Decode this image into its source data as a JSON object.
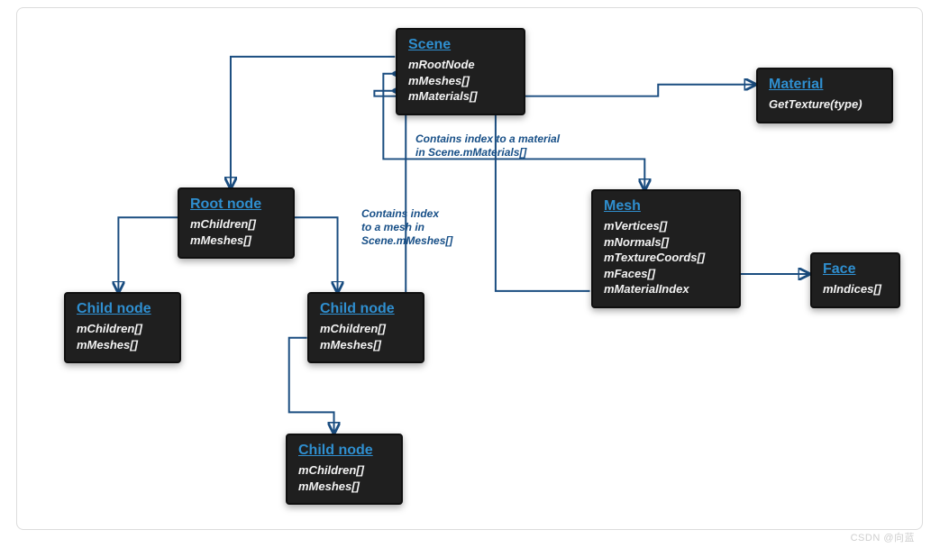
{
  "colors": {
    "bg": "#ffffff",
    "nodeBg": "#1f1f1f",
    "nodeBorder": "#0f0f0f",
    "titleLink": "#2f8fd0",
    "arrow": "#1a4d80",
    "frame": "#dcdcdc"
  },
  "scene": {
    "title": "Scene",
    "props": [
      "mRootNode",
      "mMeshes[]",
      "mMaterials[]"
    ]
  },
  "rootNode": {
    "title": "Root node",
    "props": [
      "mChildren[]",
      "mMeshes[]"
    ]
  },
  "childA": {
    "title": "Child node",
    "props": [
      "mChildren[]",
      "mMeshes[]"
    ]
  },
  "childB": {
    "title": "Child node",
    "props": [
      "mChildren[]",
      "mMeshes[]"
    ]
  },
  "childC": {
    "title": "Child node",
    "props": [
      "mChildren[]",
      "mMeshes[]"
    ]
  },
  "mesh": {
    "title": "Mesh",
    "props": [
      "mVertices[]",
      "mNormals[]",
      "mTextureCoords[]",
      "mFaces[]",
      "mMaterialIndex"
    ]
  },
  "material": {
    "title": "Material",
    "props": [
      "GetTexture(type)"
    ]
  },
  "face": {
    "title": "Face",
    "props": [
      "mIndices[]"
    ]
  },
  "labels": {
    "meshIndex": "Contains index\nto a mesh in\nScene.mMeshes[]",
    "materialIndex": "Contains index to a material\nin Scene.mMaterials[]"
  },
  "watermark": "CSDN @向蓝"
}
